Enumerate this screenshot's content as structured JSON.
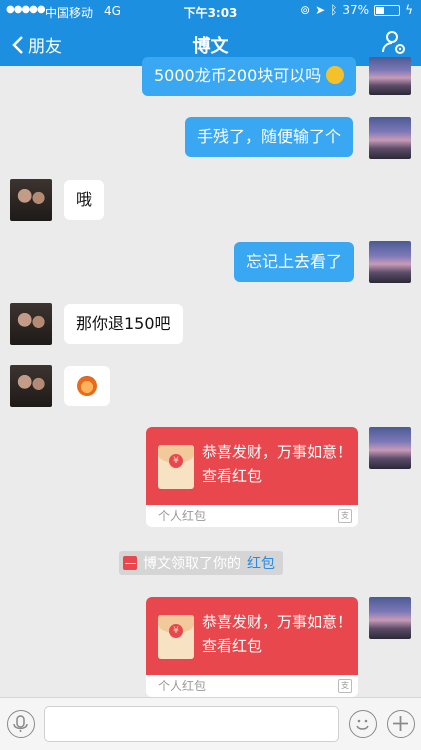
{
  "status_bar": {
    "carrier": "中国移动",
    "network": "4G",
    "time": "下午3:03",
    "battery": "37%",
    "battery_level": 0.37
  },
  "nav": {
    "back_label": "朋友",
    "title": "博文"
  },
  "messages": {
    "m1": "5000龙币200块可以吗",
    "m2": "手残了，随便输了个",
    "m3": "哦",
    "m4": "忘记上去看了",
    "m5": "那你退150吧"
  },
  "red_packets": [
    {
      "line1": "恭喜发财，万事如意！",
      "line2": "查看红包",
      "footer": "个人红包"
    },
    {
      "line1": "恭喜发财，万事如意！",
      "line2": "查看红包",
      "footer": "个人红包"
    }
  ],
  "system_note": {
    "text": "博文领取了你的",
    "link": "红包"
  },
  "colors": {
    "nav": "#1d8fe0",
    "out_bubble": "#3aa7f2",
    "red_packet": "#e8474d"
  }
}
